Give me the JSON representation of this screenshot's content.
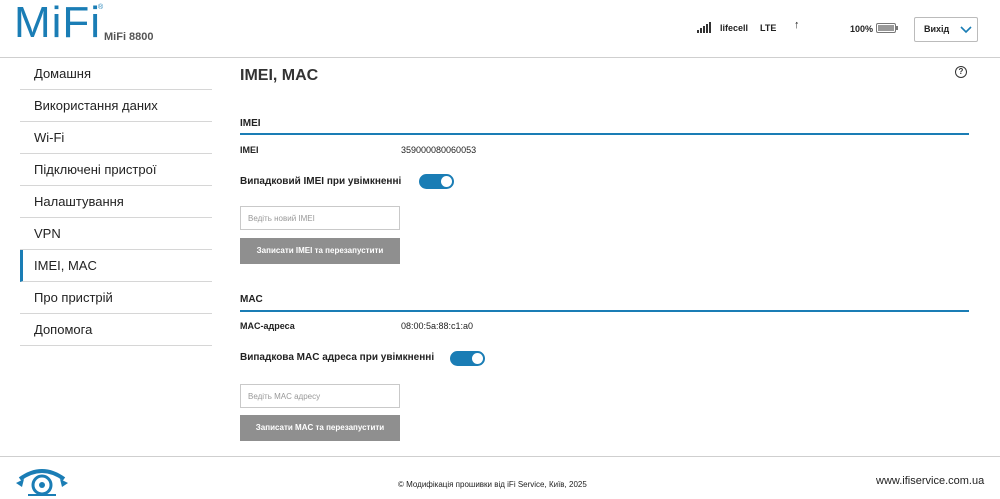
{
  "header": {
    "logo": "MiFi",
    "logo_mark": "®",
    "model": "MiFi 8800",
    "carrier": "lifecell",
    "network": "LTE",
    "upload_arrow": "↑",
    "battery_percent": "100%",
    "battery_level": 1.0,
    "logout_label": "Вихід"
  },
  "sidebar": {
    "items": [
      {
        "label": "Домашня",
        "active": false
      },
      {
        "label": "Використання даних",
        "active": false
      },
      {
        "label": "Wi-Fi",
        "active": false
      },
      {
        "label": "Підключені пристрої",
        "active": false
      },
      {
        "label": "Налаштування",
        "active": false
      },
      {
        "label": "VPN",
        "active": false
      },
      {
        "label": "IMEI, MAC",
        "active": true
      },
      {
        "label": "Про пристрій",
        "active": false
      },
      {
        "label": "Допомога",
        "active": false
      }
    ]
  },
  "main": {
    "title": "IMEI, MAC",
    "help": "?",
    "imei": {
      "section_title": "IMEI",
      "label": "IMEI",
      "value": "359000080060053",
      "toggle_label": "Випадковий IMEI при увімкненні",
      "toggle_on": true,
      "input_placeholder": "Ведіть новий IMEI",
      "input_value": "",
      "button_label": "Записати IMEI та перезапустити"
    },
    "mac": {
      "section_title": "MAC",
      "label": "MAC-адреса",
      "value": "08:00:5a:88:c1:a0",
      "toggle_label": "Випадкова MAC адреса при увімкненні",
      "toggle_on": true,
      "input_placeholder": "Ведіть MAC адресу",
      "input_value": "",
      "button_label": "Записати MAC та перезапустити"
    }
  },
  "footer": {
    "copyright": "© Модифікація прошивки від iFi Service, Київ, 2025",
    "site": "www.ifiservice.com.ua"
  },
  "icons": {
    "signal": "signal-bars-icon",
    "battery": "battery-icon",
    "chevron": "chevron-down-icon",
    "help": "help-circle-icon",
    "footer_logo": "ifi-service-logo"
  },
  "colors": {
    "accent": "#1a7db5",
    "button": "#8f8f8f",
    "divider": "#d6d6d6"
  }
}
